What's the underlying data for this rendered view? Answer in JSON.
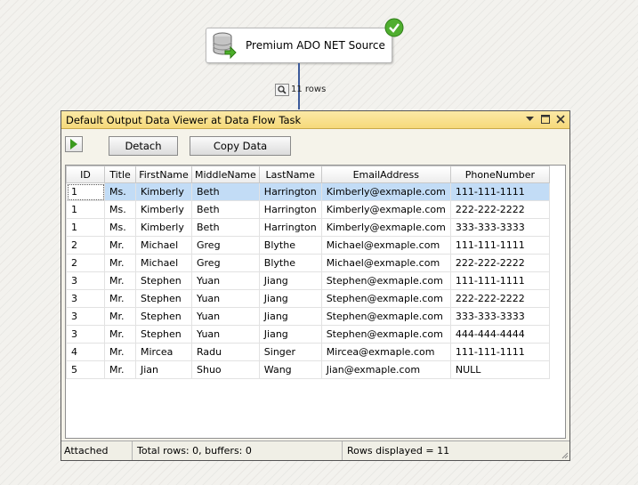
{
  "source": {
    "label": "Premium ADO NET Source",
    "icon": "database-source-icon",
    "status_icon": "success-check-icon"
  },
  "path": {
    "row_count": "11 rows",
    "icon": "data-viewer-magnifier-icon"
  },
  "viewer": {
    "title": "Default Output Data Viewer at Data Flow Task",
    "toolbar": {
      "play": "play-icon",
      "detach": "Detach",
      "copy": "Copy Data"
    },
    "columns": [
      "ID",
      "Title",
      "FirstName",
      "MiddleName",
      "LastName",
      "EmailAddress",
      "PhoneNumber"
    ],
    "rows": [
      [
        "1",
        "Ms.",
        "Kimberly",
        "Beth",
        "Harrington",
        "Kimberly@exmaple.com",
        "111-111-1111"
      ],
      [
        "1",
        "Ms.",
        "Kimberly",
        "Beth",
        "Harrington",
        "Kimberly@exmaple.com",
        "222-222-2222"
      ],
      [
        "1",
        "Ms.",
        "Kimberly",
        "Beth",
        "Harrington",
        "Kimberly@exmaple.com",
        "333-333-3333"
      ],
      [
        "2",
        "Mr.",
        "Michael",
        "Greg",
        "Blythe",
        "Michael@exmaple.com",
        "111-111-1111"
      ],
      [
        "2",
        "Mr.",
        "Michael",
        "Greg",
        "Blythe",
        "Michael@exmaple.com",
        "222-222-2222"
      ],
      [
        "3",
        "Mr.",
        "Stephen",
        "Yuan",
        "Jiang",
        "Stephen@exmaple.com",
        "111-111-1111"
      ],
      [
        "3",
        "Mr.",
        "Stephen",
        "Yuan",
        "Jiang",
        "Stephen@exmaple.com",
        "222-222-2222"
      ],
      [
        "3",
        "Mr.",
        "Stephen",
        "Yuan",
        "Jiang",
        "Stephen@exmaple.com",
        "333-333-3333"
      ],
      [
        "3",
        "Mr.",
        "Stephen",
        "Yuan",
        "Jiang",
        "Stephen@exmaple.com",
        "444-444-4444"
      ],
      [
        "4",
        "Mr.",
        "Mircea",
        "Radu",
        "Singer",
        "Mircea@exmaple.com",
        "111-111-1111"
      ],
      [
        "5",
        "Mr.",
        "Jian",
        "Shuo",
        "Wang",
        "Jian@exmaple.com",
        "NULL"
      ]
    ],
    "status": {
      "state": "Attached",
      "totals": "Total rows: 0, buffers: 0",
      "displayed": "Rows displayed = 11"
    }
  }
}
